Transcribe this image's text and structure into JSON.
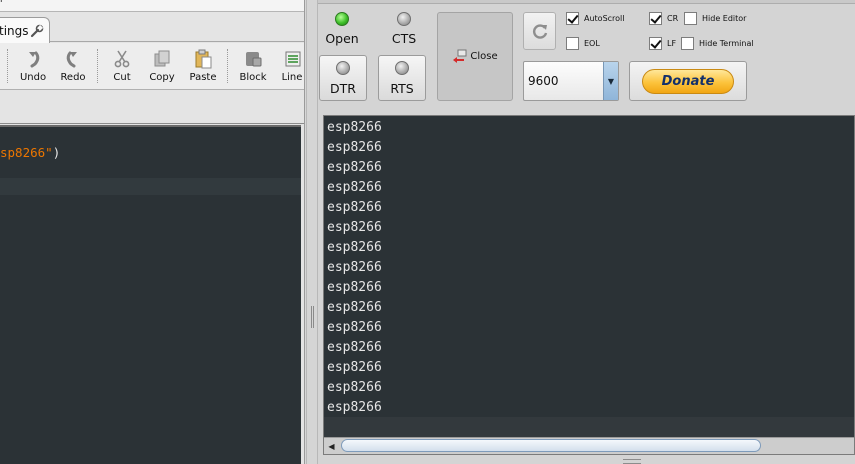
{
  "window": {
    "left_caption": "l"
  },
  "tabs": {
    "settings_label": "tings"
  },
  "toolbar": {
    "buttons": [
      {
        "label": "Undo",
        "icon": "undo-icon"
      },
      {
        "label": "Redo",
        "icon": "redo-icon"
      },
      {
        "label": "Cut",
        "icon": "cut-icon"
      },
      {
        "label": "Copy",
        "icon": "copy-icon"
      },
      {
        "label": "Paste",
        "icon": "paste-icon"
      },
      {
        "label": "Block",
        "icon": "block-icon"
      },
      {
        "label": "Line",
        "icon": "line-icon"
      }
    ]
  },
  "editor": {
    "visible_code_string": "sp8266\"",
    "visible_code_tail": ")"
  },
  "serial": {
    "open_label": "Open",
    "cts_label": "CTS",
    "dtr_label": "DTR",
    "rts_label": "RTS",
    "close_label": "Close",
    "open_led_color": "#3fc02a",
    "checkboxes": {
      "autoscroll": {
        "label": "AutoScroll",
        "checked": true
      },
      "cr": {
        "label": "CR",
        "checked": true
      },
      "hide_editor": {
        "label": "Hide Editor",
        "checked": false
      },
      "eol": {
        "label": "EOL",
        "checked": false
      },
      "lf": {
        "label": "LF",
        "checked": true
      },
      "hide_terminal": {
        "label": "Hide Terminal",
        "checked": false
      }
    },
    "baud_rate": "9600",
    "donate_label": "Donate",
    "console_lines": [
      "esp8266",
      "esp8266",
      "esp8266",
      "esp8266",
      "esp8266",
      "esp8266",
      "esp8266",
      "esp8266",
      "esp8266",
      "esp8266",
      "esp8266",
      "esp8266",
      "esp8266",
      "esp8266",
      "esp8266"
    ]
  }
}
